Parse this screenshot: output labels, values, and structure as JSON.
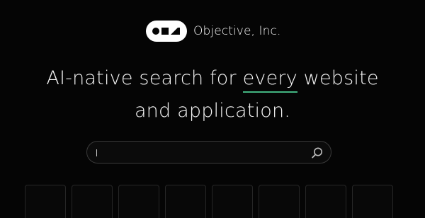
{
  "brand": {
    "logo_icon": "objective-logo-icon",
    "name": "Objective, Inc."
  },
  "headline": {
    "line1_before": "AI-native search for ",
    "line1_emphasis": "every",
    "line1_after": " website",
    "line2": "and application.",
    "emphasis_color": "#43b581"
  },
  "search": {
    "value": "",
    "placeholder": "",
    "button_icon": "search-icon"
  },
  "tiles": {
    "count_visible": 8
  },
  "colors": {
    "background": "#050505",
    "text": "#f4f4f4",
    "accent": "#43b581"
  }
}
